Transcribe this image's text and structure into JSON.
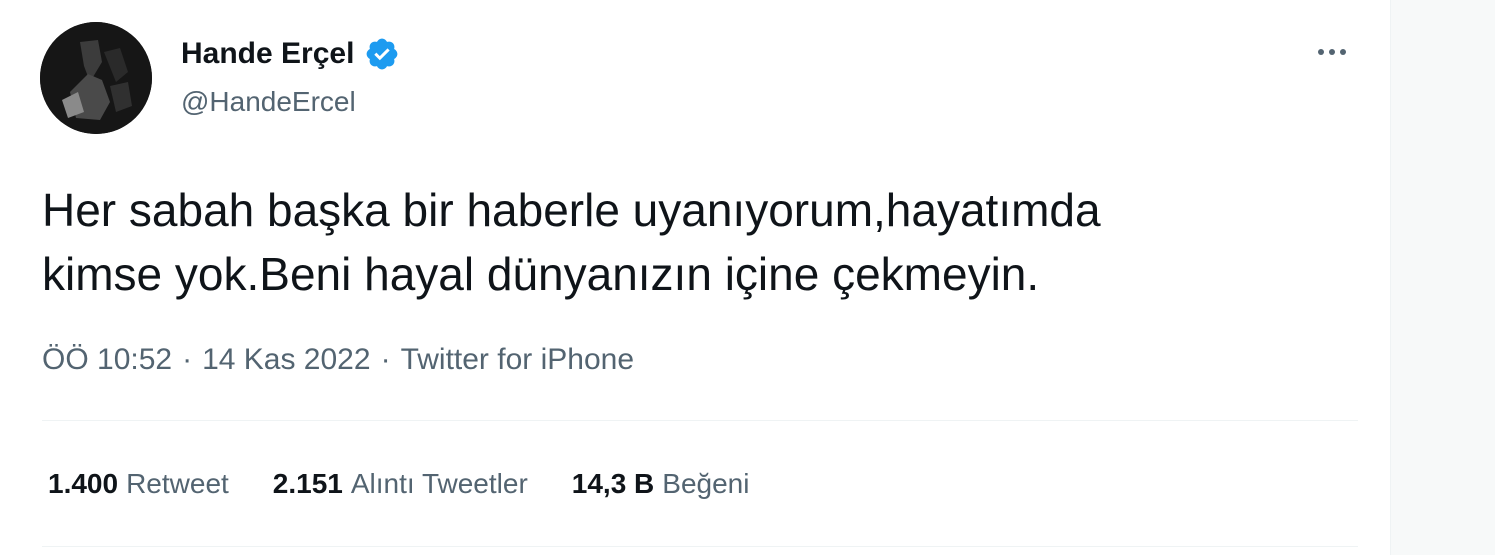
{
  "author": {
    "display_name": "Hande Erçel",
    "handle": "@HandeErcel",
    "verified": true
  },
  "tweet": {
    "text": "Her sabah başka bir haberle uyanıyorum,hayatımda\nkimse yok.Beni hayal dünyanızın içine çekmeyin.",
    "time": "ÖÖ 10:52",
    "date": "14 Kas 2022",
    "source": "Twitter for iPhone",
    "separator": "·"
  },
  "stats": {
    "retweets": {
      "count": "1.400",
      "label": "Retweet"
    },
    "quotes": {
      "count": "2.151",
      "label": "Alıntı Tweetler"
    },
    "likes": {
      "count": "14,3 B",
      "label": "Beğeni"
    }
  },
  "icons": {
    "verified": "verified-badge-icon",
    "more": "more-options-icon"
  },
  "colors": {
    "verified_blue": "#1d9bf0",
    "text_primary": "#0f1419",
    "text_secondary": "#536471",
    "divider": "#eff3f4"
  }
}
